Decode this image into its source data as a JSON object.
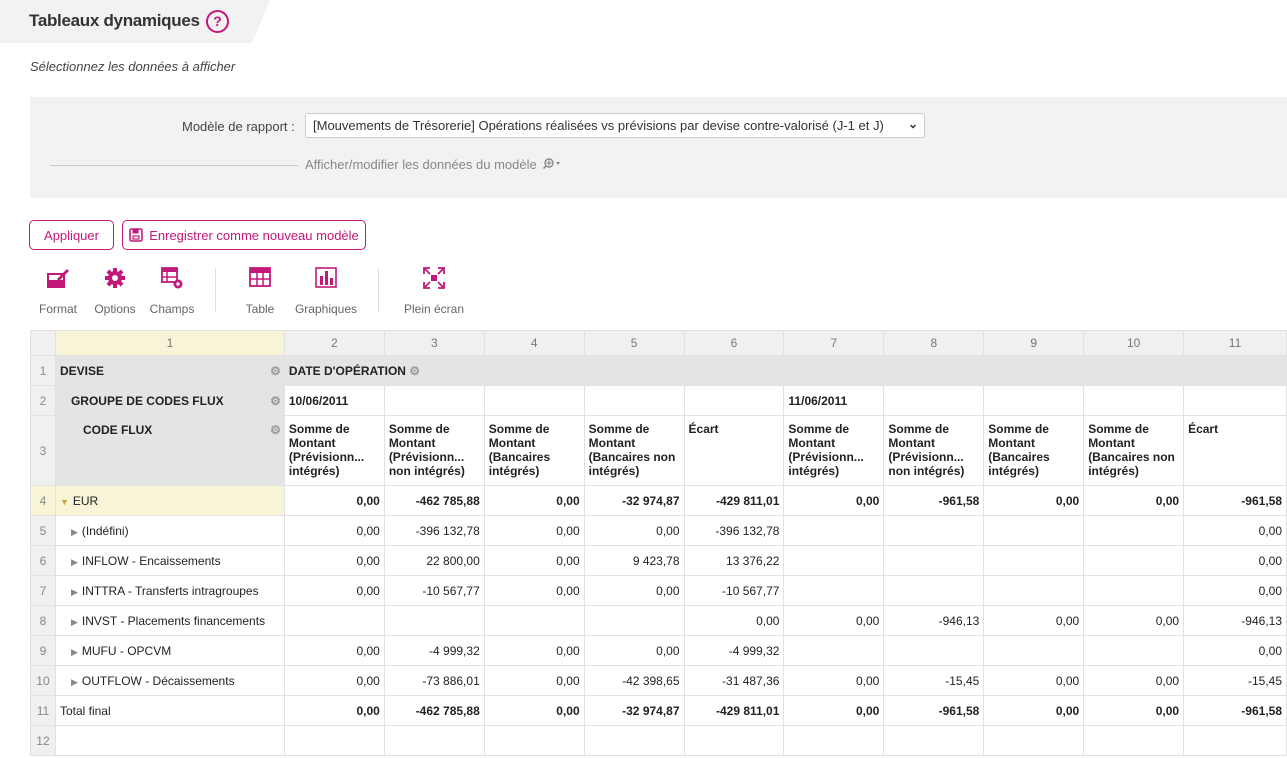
{
  "header": {
    "title": "Tableaux dynamiques",
    "help": "?",
    "subtitle": "Sélectionnez les données à afficher"
  },
  "panel": {
    "model_label": "Modèle de rapport :",
    "model_value": "[Mouvements de Trésorerie] Opérations réalisées vs prévisions par devise contre-valorisé (J-1 et J)",
    "show_link": "Afficher/modifier les données du modèle"
  },
  "buttons": {
    "apply": "Appliquer",
    "save_model": "Enregistrer comme nouveau modèle"
  },
  "toolbar": {
    "format": "Format",
    "options": "Options",
    "champs": "Champs",
    "table": "Table",
    "graphiques": "Graphiques",
    "plein_ecran": "Plein écran"
  },
  "accent": "#c2187a",
  "grid": {
    "col_headers": [
      "1",
      "2",
      "3",
      "4",
      "5",
      "6",
      "7",
      "8",
      "9",
      "10",
      "11"
    ],
    "row_numbers": [
      "1",
      "2",
      "3",
      "4",
      "5",
      "6",
      "7",
      "8",
      "9",
      "10",
      "11",
      "12"
    ],
    "devise": "DEVISE",
    "date_op": "DATE D'OPÉRATION",
    "groupe": "GROUPE DE CODES FLUX",
    "code_flux": "CODE FLUX",
    "date1": "10/06/2011",
    "date2": "11/06/2011",
    "measures": [
      "Somme de Montant (Prévisionn... intégrés)",
      "Somme de Montant (Prévisionn... non intégrés)",
      "Somme de Montant (Bancaires intégrés)",
      "Somme de Montant (Bancaires non intégrés)",
      "Écart",
      "Somme de Montant (Prévisionn... intégrés)",
      "Somme de Montant (Prévisionn... non intégrés)",
      "Somme de Montant (Bancaires intégrés)",
      "Somme de Montant (Bancaires non intégrés)",
      "Écart"
    ],
    "rows": [
      {
        "label": "EUR",
        "type": "group",
        "values": [
          "0,00",
          "-462 785,88",
          "0,00",
          "-32 974,87",
          "-429 811,01",
          "0,00",
          "-961,58",
          "0,00",
          "0,00",
          "-961,58"
        ]
      },
      {
        "label": "(Indéfini)",
        "type": "child",
        "values": [
          "0,00",
          "-396 132,78",
          "0,00",
          "0,00",
          "-396 132,78",
          "",
          "",
          "",
          "",
          "0,00"
        ]
      },
      {
        "label": "INFLOW - Encaissements",
        "type": "child",
        "values": [
          "0,00",
          "22 800,00",
          "0,00",
          "9 423,78",
          "13 376,22",
          "",
          "",
          "",
          "",
          "0,00"
        ]
      },
      {
        "label": "INTTRA - Transferts intragroupes",
        "type": "child",
        "values": [
          "0,00",
          "-10 567,77",
          "0,00",
          "0,00",
          "-10 567,77",
          "",
          "",
          "",
          "",
          "0,00"
        ]
      },
      {
        "label": "INVST - Placements financements",
        "type": "child",
        "values": [
          "",
          "",
          "",
          "",
          "0,00",
          "0,00",
          "-946,13",
          "0,00",
          "0,00",
          "-946,13"
        ]
      },
      {
        "label": "MUFU - OPCVM",
        "type": "child",
        "values": [
          "0,00",
          "-4 999,32",
          "0,00",
          "0,00",
          "-4 999,32",
          "",
          "",
          "",
          "",
          "0,00"
        ]
      },
      {
        "label": "OUTFLOW - Décaissements",
        "type": "child",
        "values": [
          "0,00",
          "-73 886,01",
          "0,00",
          "-42 398,65",
          "-31 487,36",
          "0,00",
          "-15,45",
          "0,00",
          "0,00",
          "-15,45"
        ]
      },
      {
        "label": "Total final",
        "type": "total",
        "values": [
          "0,00",
          "-462 785,88",
          "0,00",
          "-32 974,87",
          "-429 811,01",
          "0,00",
          "-961,58",
          "0,00",
          "0,00",
          "-961,58"
        ]
      }
    ]
  }
}
